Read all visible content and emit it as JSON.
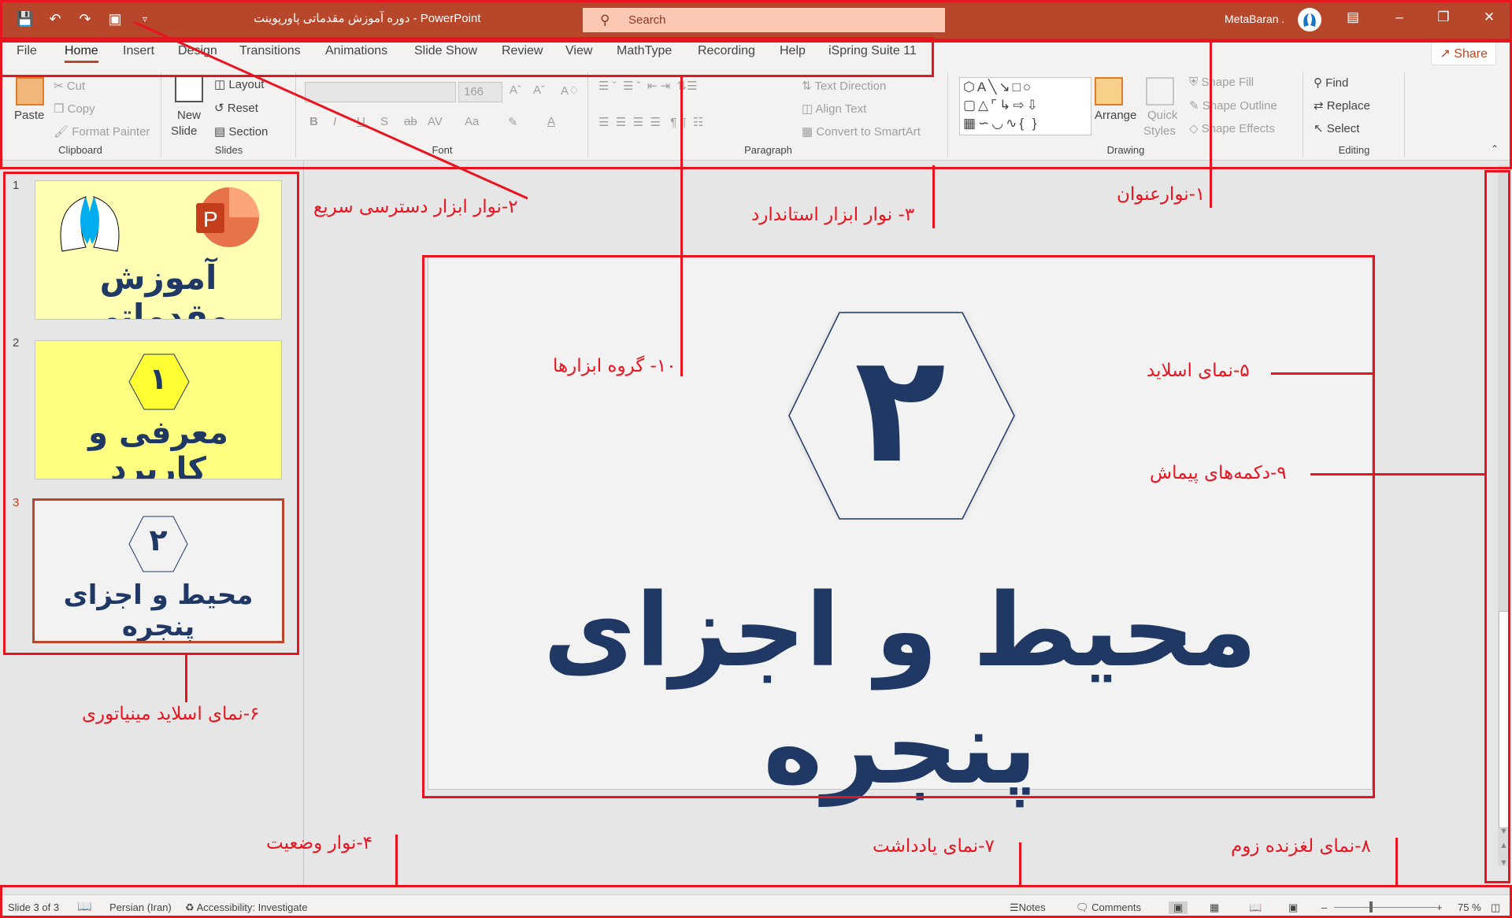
{
  "window": {
    "title": "دوره آموزش مقدماتی پاورپوینت  -  PowerPoint",
    "search_placeholder": "Search",
    "user": "MetaBaran .",
    "accent": "#b7472a"
  },
  "qat": [
    "save-icon",
    "undo-icon",
    "redo-icon",
    "start-slideshow-icon",
    "customize-qat-icon"
  ],
  "tabs": [
    "File",
    "Home",
    "Insert",
    "Design",
    "Transitions",
    "Animations",
    "Slide Show",
    "Review",
    "View",
    "MathType",
    "Recording",
    "Help",
    "iSpring Suite 11"
  ],
  "active_tab": "Home",
  "share_label": "Share",
  "ribbon": {
    "clipboard": {
      "label": "Clipboard",
      "paste": "Paste",
      "cut": "Cut",
      "copy": "Copy",
      "format_painter": "Format Painter"
    },
    "slides": {
      "label": "Slides",
      "new_slide_1": "New",
      "new_slide_2": "Slide",
      "layout": "Layout",
      "reset": "Reset",
      "section": "Section"
    },
    "font": {
      "label": "Font",
      "font_name": "",
      "font_size": "166",
      "bold": "B",
      "italic": "I",
      "underline": "U",
      "shadow": "S",
      "strike": "ab",
      "spacing": "AV",
      "case": "Aa"
    },
    "paragraph": {
      "label": "Paragraph",
      "text_direction": "Text Direction",
      "align_text": "Align Text",
      "smartart": "Convert to SmartArt"
    },
    "drawing": {
      "label": "Drawing",
      "arrange": "Arrange",
      "quick_styles_1": "Quick",
      "quick_styles_2": "Styles",
      "shape_fill": "Shape Fill",
      "shape_outline": "Shape Outline",
      "shape_effects": "Shape Effects"
    },
    "editing": {
      "label": "Editing",
      "find": "Find",
      "replace": "Replace",
      "select": "Select"
    }
  },
  "thumbnails": [
    {
      "num": "1",
      "title": "آموزش مقدماتی",
      "bg": "#ffffb3"
    },
    {
      "num": "2",
      "title": "معرفی و کاربرد",
      "hex": "۱",
      "bg": "#ffff80"
    },
    {
      "num": "3",
      "title": "محیط و اجزای پنجره",
      "hex": "۲",
      "bg": "#f2f2f2",
      "selected": true
    }
  ],
  "slide": {
    "hex_number": "۲",
    "title": "محیط و اجزای پنجره"
  },
  "status": {
    "slide_of": "Slide 3 of 3",
    "language": "Persian (Iran)",
    "accessibility": "Accessibility: Investigate",
    "notes": "Notes",
    "comments": "Comments",
    "zoom_percent": "75 %",
    "zoom_value": 75
  },
  "annotations": {
    "a1": "۱-نوارعنوان",
    "a2": "۲-نوار ابزار دسترسی سریع",
    "a3": "۳- نوار ابزار استاندارد",
    "a4": "۴-نوار وضعیت",
    "a5": "۵-نمای اسلاید",
    "a6": "۶-نمای اسلاید مینیاتوری",
    "a7": "۷-نمای یادداشت",
    "a8": "۸-نمای لغزنده زوم",
    "a9": "۹-دکمه‌های پیماش",
    "a10": "۱۰- گروه ابزارها",
    "color": "#e8141f"
  }
}
